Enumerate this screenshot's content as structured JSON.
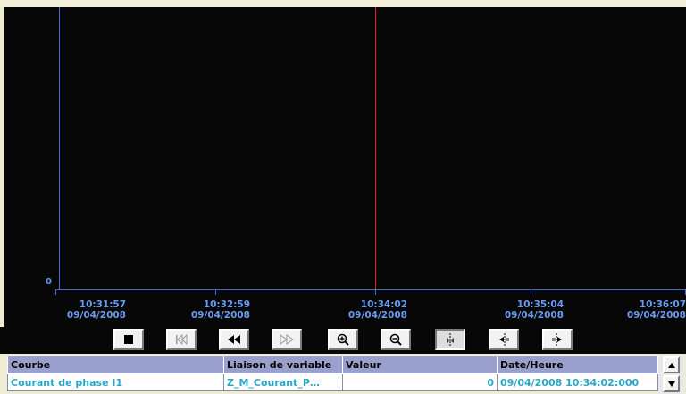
{
  "colors": {
    "plot_background": "#070707",
    "axis_color": "#3f6fd6",
    "axis_label_color": "#6a9bf0",
    "cursor_color": "#e02020",
    "table_header_bg": "#9aa0cd",
    "table_value_color": "#2aa7c6"
  },
  "trend": {
    "y_axis_label": "0",
    "x_labels": [
      {
        "time": "10:31:57",
        "date": "09/04/2008"
      },
      {
        "time": "10:32:59",
        "date": "09/04/2008"
      },
      {
        "time": "10:34:02",
        "date": "09/04/2008"
      },
      {
        "time": "10:35:04",
        "date": "09/04/2008"
      },
      {
        "time": "10:36:07",
        "date": "09/04/2008"
      }
    ]
  },
  "toolbar": {
    "buttons": [
      {
        "name": "stop-button",
        "icon": "stop-icon",
        "state": "normal"
      },
      {
        "name": "first-button",
        "icon": "skip-to-start-icon",
        "state": "disabled"
      },
      {
        "name": "rewind-button",
        "icon": "rewind-icon",
        "state": "normal"
      },
      {
        "name": "forward-button",
        "icon": "fast-forward-icon",
        "state": "disabled"
      },
      {
        "name": "zoom-in-button",
        "icon": "zoom-in-icon",
        "state": "normal"
      },
      {
        "name": "zoom-out-button",
        "icon": "zoom-out-icon",
        "state": "normal"
      },
      {
        "name": "ruler-button",
        "icon": "ruler-cursor-icon",
        "state": "pressed"
      },
      {
        "name": "cursor-left-button",
        "icon": "cursor-left-icon",
        "state": "normal"
      },
      {
        "name": "cursor-right-button",
        "icon": "cursor-right-icon",
        "state": "normal"
      }
    ]
  },
  "table": {
    "headers": [
      "Courbe",
      "Liaison de variable",
      "Valeur",
      "Date/Heure"
    ],
    "rows": [
      [
        "Courant de phase I1",
        "Z_M_Courant_P…",
        "0",
        "09/04/2008 10:34:02:000"
      ]
    ],
    "scroll_up_icon": "scroll-up-arrow-icon",
    "scroll_down_icon": "scroll-down-arrow-icon"
  }
}
